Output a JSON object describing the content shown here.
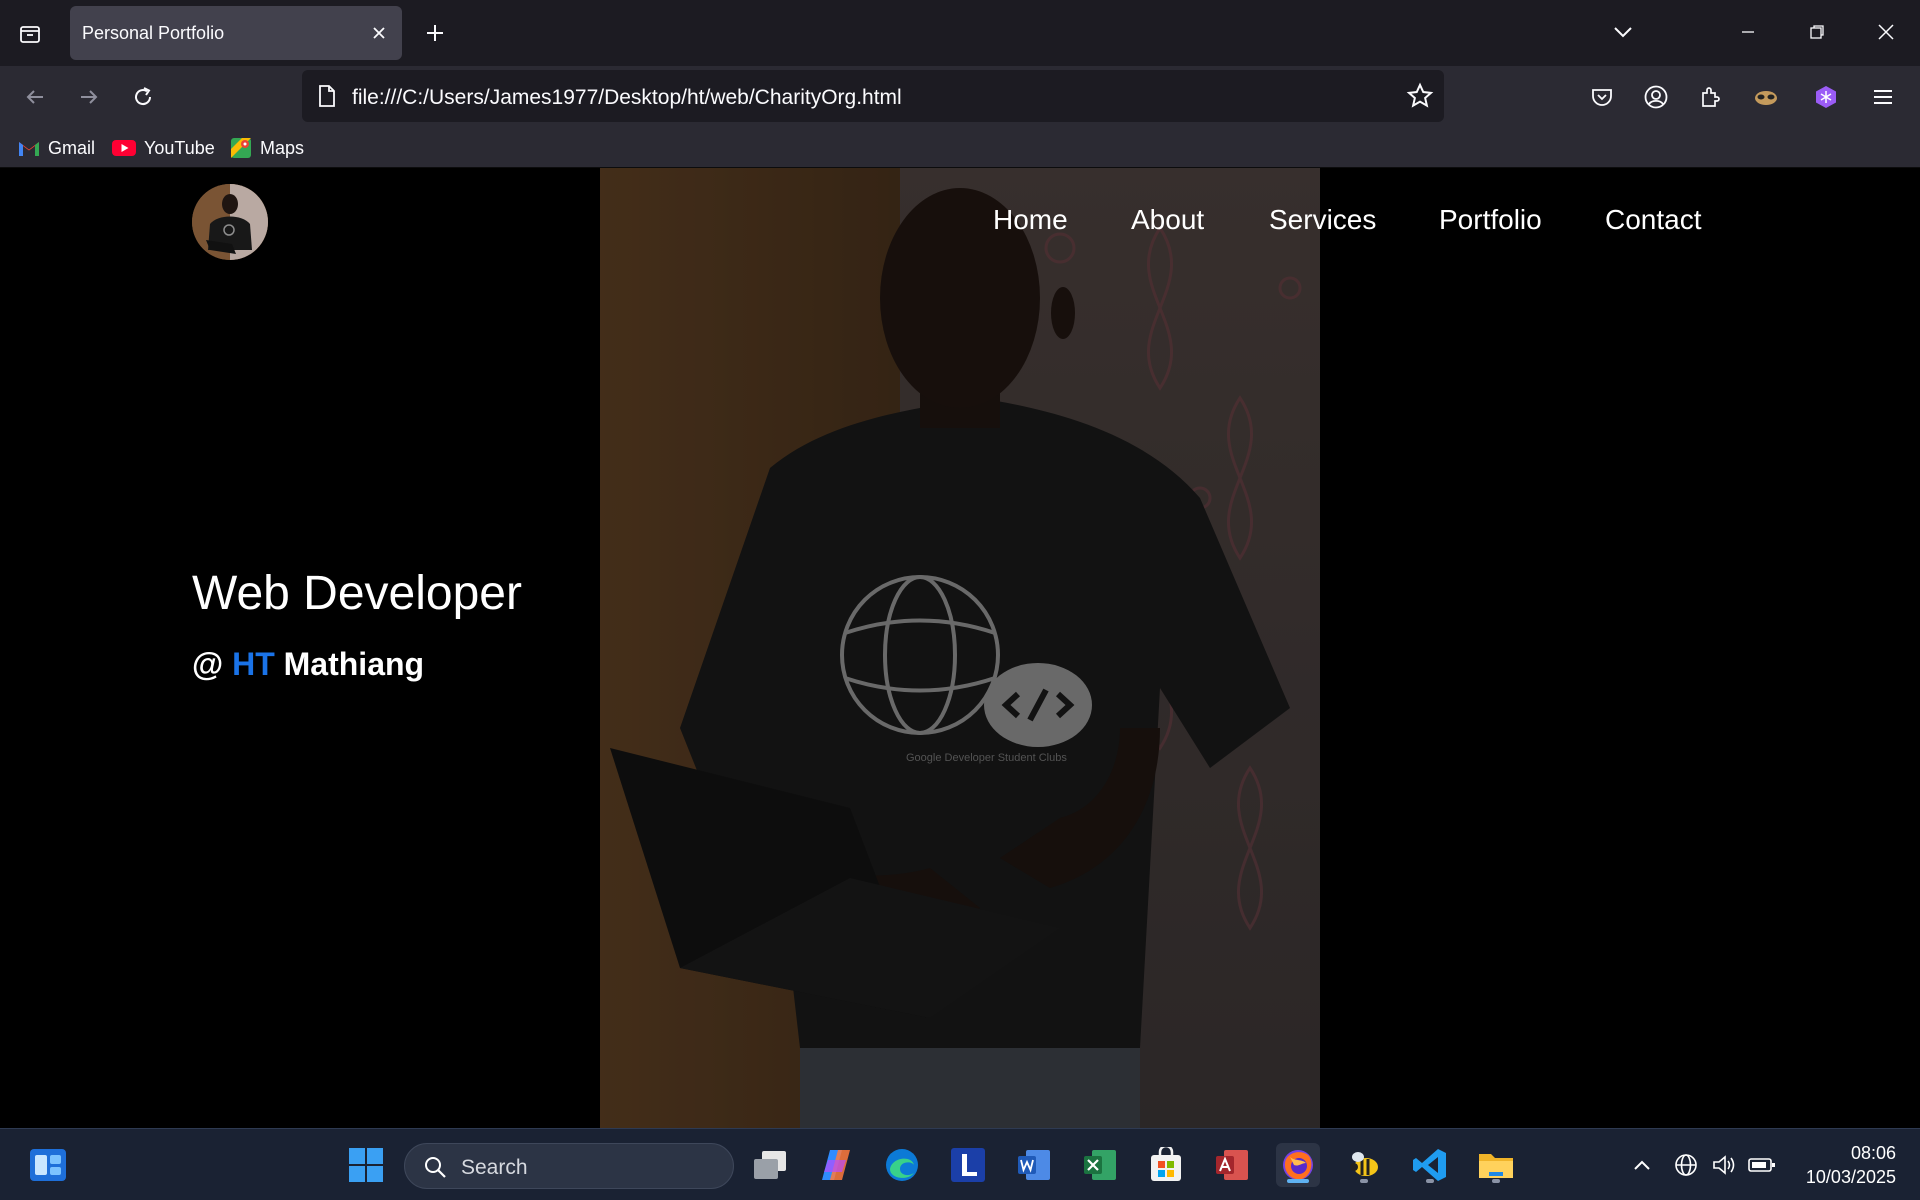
{
  "browser": {
    "tab_title": "Personal Portfolio",
    "url": "file:///C:/Users/James1977/Desktop/ht/web/CharityOrg.html",
    "bookmarks": [
      {
        "label": "Gmail"
      },
      {
        "label": "YouTube"
      },
      {
        "label": "Maps"
      }
    ]
  },
  "site": {
    "nav": [
      "Home",
      "About",
      "Services",
      "Portfolio",
      "Contact"
    ],
    "headline": "Web Developer",
    "sub_prefix": "@",
    "sub_highlight": "HT",
    "sub_name": "Mathiang",
    "shirt_text": "Google Developer Student Clubs"
  },
  "taskbar": {
    "search_placeholder": "Search",
    "time": "08:06",
    "date": "10/03/2025"
  },
  "colors": {
    "accent": "#1a73e8",
    "page_bg": "#000000",
    "browser_bg": "#1c1b22",
    "taskbar_bg": "#1a2233"
  }
}
